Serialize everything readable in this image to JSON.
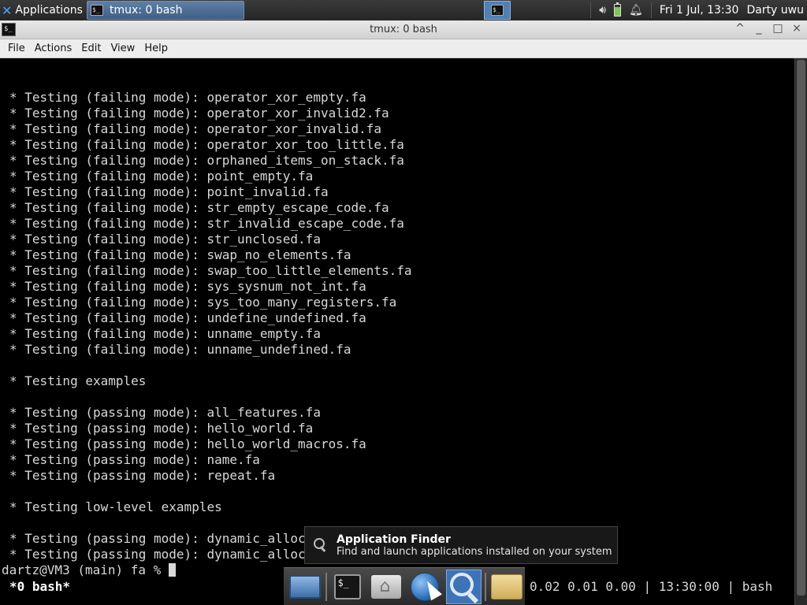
{
  "top_panel": {
    "apps_label": "Applications",
    "task_title": "tmux: 0 bash",
    "clock": "Fri  1 Jul, 13:30",
    "user": "Darty uwu",
    "icons": [
      "xfce-icon",
      "terminal-icon",
      "volume-icon",
      "battery-icon",
      "notification-bell-icon"
    ]
  },
  "window": {
    "title": "tmux: 0 bash",
    "controls": [
      "^",
      "_",
      "□",
      "×"
    ]
  },
  "menu": [
    "File",
    "Actions",
    "Edit",
    "View",
    "Help"
  ],
  "terminal": {
    "lines": [
      "* Testing (failing mode): operator_xor_empty.fa",
      "* Testing (failing mode): operator_xor_invalid2.fa",
      "* Testing (failing mode): operator_xor_invalid.fa",
      "* Testing (failing mode): operator_xor_too_little.fa",
      "* Testing (failing mode): orphaned_items_on_stack.fa",
      "* Testing (failing mode): point_empty.fa",
      "* Testing (failing mode): point_invalid.fa",
      "* Testing (failing mode): str_empty_escape_code.fa",
      "* Testing (failing mode): str_invalid_escape_code.fa",
      "* Testing (failing mode): str_unclosed.fa",
      "* Testing (failing mode): swap_no_elements.fa",
      "* Testing (failing mode): swap_too_little_elements.fa",
      "* Testing (failing mode): sys_sysnum_not_int.fa",
      "* Testing (failing mode): sys_too_many_registers.fa",
      "* Testing (failing mode): undefine_undefined.fa",
      "* Testing (failing mode): unname_empty.fa",
      "* Testing (failing mode): unname_undefined.fa",
      "",
      "* Testing examples",
      "",
      "* Testing (passing mode): all_features.fa",
      "* Testing (passing mode): hello_world.fa",
      "* Testing (passing mode): hello_world_macros.fa",
      "* Testing (passing mode): name.fa",
      "* Testing (passing mode): repeat.fa",
      "",
      "* Testing low-level examples",
      "",
      "* Testing (passing mode): dynamic_alloc.fa",
      "* Testing (passing mode): dynamic_alloc_mmap.fa"
    ],
    "prompt": "dartz@VM3 (main) fa % ",
    "status_left": "*0 bash*",
    "status_right": "0.02 0.01 0.00 | 13:30:00 | bash"
  },
  "tooltip": {
    "title": "Application Finder",
    "description": "Find and launch applications installed on your system"
  },
  "dock": {
    "items": [
      "show-desktop-icon",
      "terminal-icon",
      "home-folder-icon",
      "web-browser-icon",
      "application-finder-icon",
      "folder-icon"
    ]
  }
}
